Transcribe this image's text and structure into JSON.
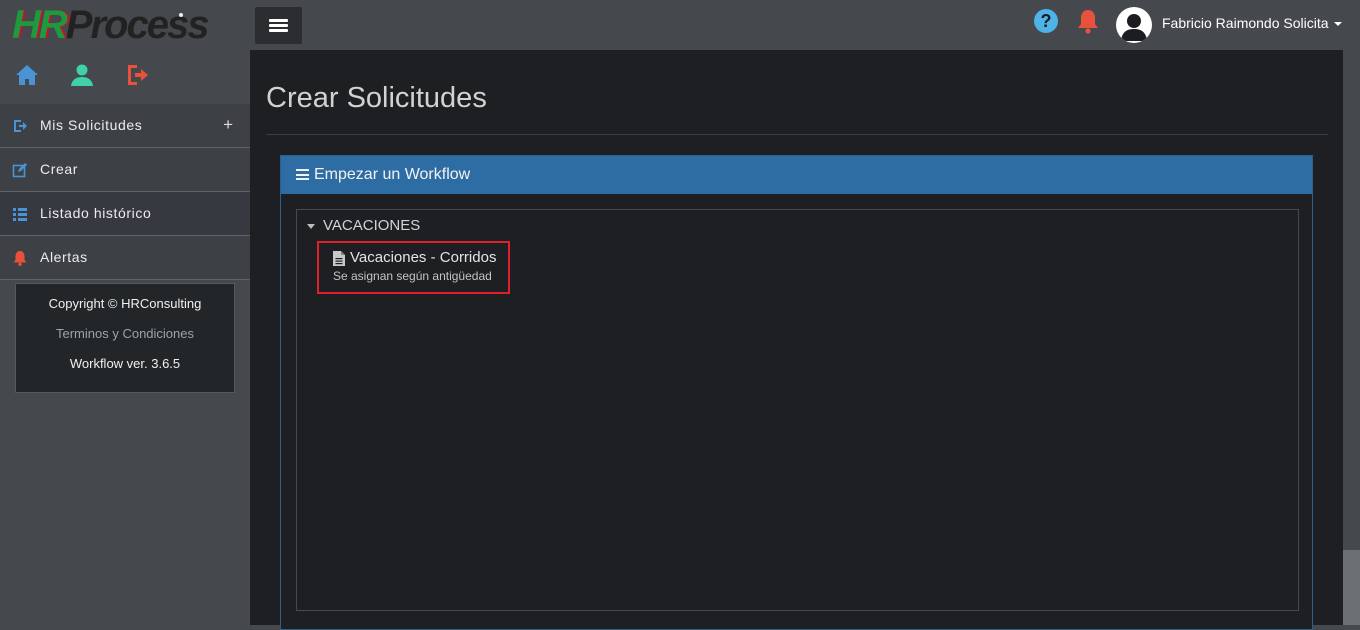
{
  "header": {
    "logo_part1": "HR",
    "logo_part2": "Process",
    "user_name": "Fabricio Raimondo Solicita",
    "icons": [
      "menu-icon",
      "help-icon",
      "bell-icon",
      "user-avatar-icon",
      "caret-down-icon"
    ]
  },
  "sidebar": {
    "quick_icons": [
      "home-icon",
      "user-icon",
      "logout-icon"
    ],
    "items": [
      {
        "label": "Mis Solicitudes",
        "icon": "sign-out-icon",
        "extra": "+"
      },
      {
        "label": "Crear",
        "icon": "edit-icon"
      },
      {
        "label": "Listado histórico",
        "icon": "list-icon"
      },
      {
        "label": "Alertas",
        "icon": "bell-icon"
      }
    ],
    "footer": {
      "copyright": "Copyright © HRConsulting",
      "terms": "Terminos y Condiciones",
      "version": "Workflow ver. 3.6.5"
    }
  },
  "main": {
    "title": "Crear Solicitudes",
    "panel_title": "Empezar un Workflow",
    "group_label": "VACACIONES",
    "workflow_item": {
      "title": "Vacaciones - Corridos",
      "subtitle": "Se asignan según antigüedad"
    }
  },
  "colors": {
    "accent_blue": "#2e6da4",
    "highlight_red": "#e0212b",
    "help_blue": "#4fb3e8",
    "alert_red": "#e8513c",
    "user_green": "#3fd2a8"
  }
}
